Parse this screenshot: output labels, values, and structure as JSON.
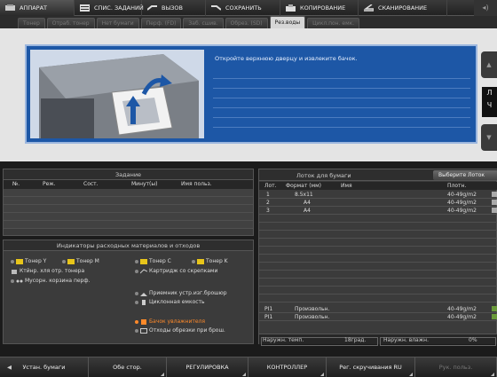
{
  "menu": {
    "items": [
      {
        "label": "АППАРАТ",
        "icon": "machine-icon"
      },
      {
        "label": "СПИС. ЗАДАНИЙ",
        "icon": "job-list-icon"
      },
      {
        "label": "ВЫЗОВ",
        "icon": "recall-icon"
      },
      {
        "label": "СОХРАНИТЬ",
        "icon": "save-icon"
      },
      {
        "label": "КОПИРОВАНИЕ",
        "icon": "copy-icon"
      },
      {
        "label": "СКАНИРОВАНИЕ",
        "icon": "scan-icon"
      }
    ],
    "right_icon": "speaker-icon"
  },
  "status_tabs": [
    {
      "label": "Тонер",
      "active": false
    },
    {
      "label": "Отраб. тонер",
      "active": false
    },
    {
      "label": "Нет бумаги",
      "active": false
    },
    {
      "label": "Перф. (FD)",
      "active": false
    },
    {
      "label": "Заб. сшив.",
      "active": false
    },
    {
      "label": "Обрез. (SD)",
      "active": false
    },
    {
      "label": "Рез.воды",
      "active": true
    },
    {
      "label": "Цикл.пон. емк.",
      "active": false
    }
  ],
  "message": {
    "text": "Откройте верхнюю дверцу и извлеките бачок.",
    "illustration_icon": "open-door-remove-tank-illustration"
  },
  "side": {
    "up_icon": "scroll-up-icon",
    "down_icon": "scroll-down-icon",
    "label_top": "Л",
    "label_bottom": "Ч"
  },
  "job_panel": {
    "title": "Задание",
    "columns": [
      "№.",
      "Реж.",
      "Сост.",
      "Минут(ы)",
      "Имя польз."
    ]
  },
  "consumables": {
    "title": "Индикаторы расходных материалов и отходов",
    "items": [
      {
        "label": "Тонер Y",
        "alert": false,
        "icon": "toner-icon"
      },
      {
        "label": "Тонер M",
        "alert": false,
        "icon": "toner-icon"
      },
      {
        "label": "Тонер C",
        "alert": false,
        "icon": "toner-icon"
      },
      {
        "label": "Тонер K",
        "alert": false,
        "icon": "toner-icon"
      },
      {
        "label": "Ктйнр. хля отр. тонера",
        "alert": false,
        "icon": "waste-toner-icon"
      },
      {
        "label": "Картридж со скрепками",
        "alert": false,
        "icon": "staple-icon"
      },
      {
        "label": "Мусорн. корзина перф.",
        "alert": false,
        "icon": "punch-waste-icon"
      },
      {
        "label": "Приемник устр.изг.брошюр",
        "alert": false,
        "icon": "booklet-tray-icon"
      },
      {
        "label": "Циклонная емкость",
        "alert": false,
        "icon": "cyclone-icon"
      },
      {
        "label": "Бачок увлажнителя",
        "alert": true,
        "icon": "humidifier-icon"
      },
      {
        "label": "Отходы обрезки при брош.",
        "alert": false,
        "icon": "trim-waste-icon"
      }
    ]
  },
  "tray_panel": {
    "title": "Лоток для бумаги",
    "select_button": "Выберите Лоток",
    "columns": [
      "Лот.",
      "Формат (мм)",
      "Имя",
      "Плотн."
    ],
    "rows": [
      {
        "tray": "1",
        "size": "8.5x11",
        "name": "",
        "weight": "40-49g/m2"
      },
      {
        "tray": "2",
        "size": "A4",
        "name": "",
        "weight": "40-49g/m2"
      },
      {
        "tray": "3",
        "size": "A4",
        "name": "",
        "weight": "40-49g/m2"
      },
      {
        "tray": "PI1",
        "size": "Произвольн.",
        "name": "",
        "weight": "40-49g/m2"
      },
      {
        "tray": "PI1",
        "size": "Произвольн.",
        "name": "",
        "weight": "40-49g/m2"
      }
    ],
    "status": {
      "temp_label": "Наружн. темп.",
      "temp_value": "18град.",
      "hum_label": "Наружн. влажн.",
      "hum_value": "0%"
    }
  },
  "bottom_bar": {
    "buttons": [
      {
        "label": "Устан. бумаги",
        "enabled": true
      },
      {
        "label": "Обе стор.",
        "enabled": true
      },
      {
        "label": "РЕГУЛИРОВКА",
        "enabled": true
      },
      {
        "label": "КОНТРОЛЛЕР",
        "enabled": true
      },
      {
        "label": "Рег. скручивания RU",
        "enabled": true
      },
      {
        "label": "Рук. польз.",
        "enabled": false
      }
    ]
  },
  "colors": {
    "accent_blue": "#1d57a6",
    "alert_orange": "#ff8a2a",
    "toner_yellow": "#e8c51a"
  }
}
